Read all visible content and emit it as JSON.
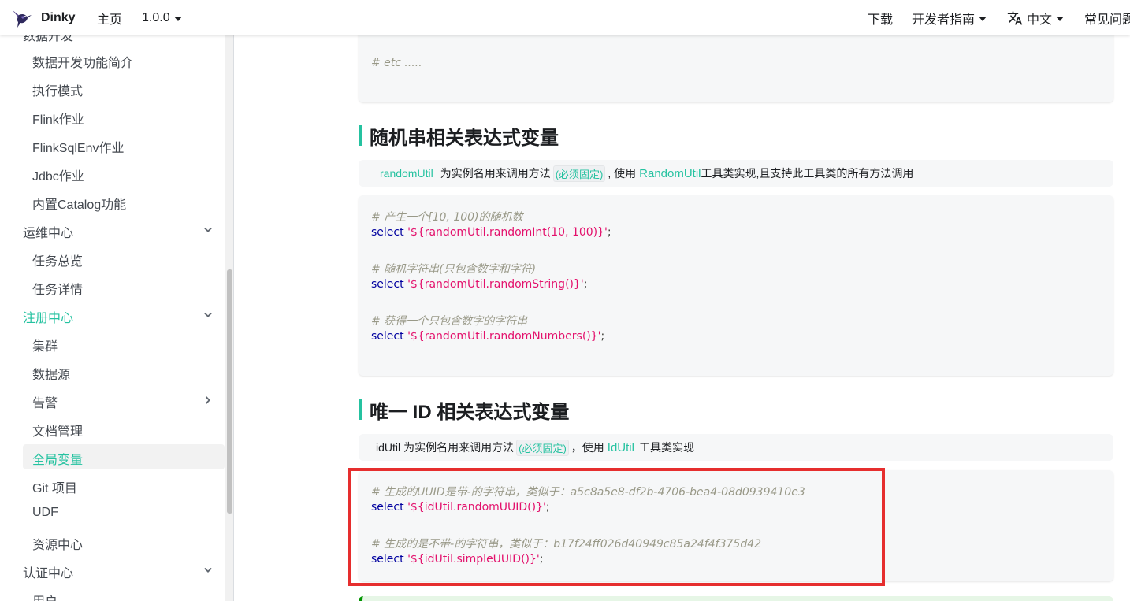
{
  "navbar": {
    "brand": "Dinky",
    "home": "主页",
    "version": "1.0.0",
    "download": "下载",
    "dev_guide": "开发者指南",
    "language": "中文",
    "faq": "常见问题"
  },
  "sidebar": {
    "top_cut": "数据开发",
    "items": [
      "数据开发功能简介",
      "执行模式",
      "Flink作业",
      "FlinkSqlEnv作业",
      "Jdbc作业",
      "内置Catalog功能",
      "运维中心",
      "任务总览",
      "任务详情",
      "注册中心",
      "集群",
      "数据源",
      "告警",
      "文档管理",
      "全局变量",
      "Git 项目",
      "UDF",
      "资源中心",
      "认证中心",
      "用户"
    ],
    "active": "全局变量"
  },
  "content": {
    "top_code_comment": "# etc .....",
    "section_random": {
      "title": "随机串相关表达式变量",
      "note_var": "randomUtil",
      "note_mid": "为实例名用来调用方法",
      "note_badge": "(必须固定)",
      "note_use": ", 使用",
      "note_util": "RandomUtil",
      "note_tail": "工具类实现,且支持此工具类的所有方法调用",
      "code": {
        "c1": "# 产生一个[10, 100)的随机数",
        "s1_kw": "select",
        "s1_str": "'${randomUtil.randomInt(10, 100)}'",
        "c2": "# 随机字符串(只包含数字和字符)",
        "s2_kw": "select",
        "s2_str": "'${randomUtil.randomString()}'",
        "c3": "# 获得一个只包含数字的字符串",
        "s3_kw": "select",
        "s3_str": "'${randomUtil.randomNumbers()}'",
        "semi": ";"
      }
    },
    "section_id": {
      "title": "唯一 ID 相关表达式变量",
      "note_var": "idUtil",
      "note_mid": "为实例名用来调用方法",
      "note_badge": "(必须固定)",
      "note_use": "，使用",
      "note_util": "IdUtil",
      "note_tail": "工具类实现",
      "code": {
        "c1": "# 生成的UUID是带-的字符串，类似于：a5c8a5e8-df2b-4706-bea4-08d0939410e3",
        "s1_kw": "select",
        "s1_str": "'${idUtil.randomUUID()}'",
        "c2": "# 生成的是不带-的字符串，类似于：b17f24ff026d40949c85a24f4f375d42",
        "s2_kw": "select",
        "s2_str": "'${idUtil.simpleUUID()}'",
        "semi": ";"
      }
    }
  },
  "colors": {
    "accent": "#25c2a0",
    "highlight": "#e62e2e"
  }
}
